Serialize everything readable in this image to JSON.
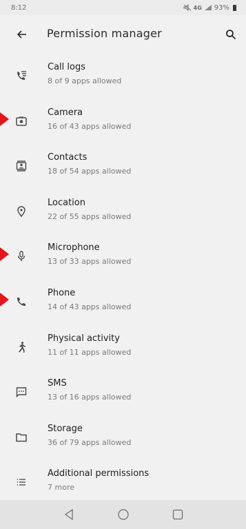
{
  "status_bar": {
    "time": "8:12",
    "network": "4G",
    "battery": "93%"
  },
  "app_bar": {
    "title": "Permission manager",
    "back_icon": "arrow-back-icon",
    "search_icon": "search-icon"
  },
  "permissions": [
    {
      "label": "Call logs",
      "sub": "8 of 9 apps allowed",
      "icon": "call-log-icon",
      "marked": false
    },
    {
      "label": "Camera",
      "sub": "16 of 43 apps allowed",
      "icon": "camera-icon",
      "marked": true
    },
    {
      "label": "Contacts",
      "sub": "18 of 54 apps allowed",
      "icon": "contacts-icon",
      "marked": false
    },
    {
      "label": "Location",
      "sub": "22 of 55 apps allowed",
      "icon": "location-icon",
      "marked": false
    },
    {
      "label": "Microphone",
      "sub": "13 of 33 apps allowed",
      "icon": "microphone-icon",
      "marked": true
    },
    {
      "label": "Phone",
      "sub": "14 of 43 apps allowed",
      "icon": "phone-icon",
      "marked": true
    },
    {
      "label": "Physical activity",
      "sub": "11 of 11 apps allowed",
      "icon": "physical-activity-icon",
      "marked": false
    },
    {
      "label": "SMS",
      "sub": "13 of 16 apps allowed",
      "icon": "sms-icon",
      "marked": false
    },
    {
      "label": "Storage",
      "sub": "36 of 79 apps allowed",
      "icon": "folder-icon",
      "marked": false
    },
    {
      "label": "Additional permissions",
      "sub": "7 more",
      "icon": "list-icon",
      "marked": false
    }
  ],
  "nav_bar": {
    "back_icon": "nav-back-icon",
    "home_icon": "nav-home-icon",
    "recents_icon": "nav-recents-icon"
  },
  "colors": {
    "background": "#f1f1f1",
    "marker": "#e8131b",
    "icon": "#4a4a4a"
  }
}
